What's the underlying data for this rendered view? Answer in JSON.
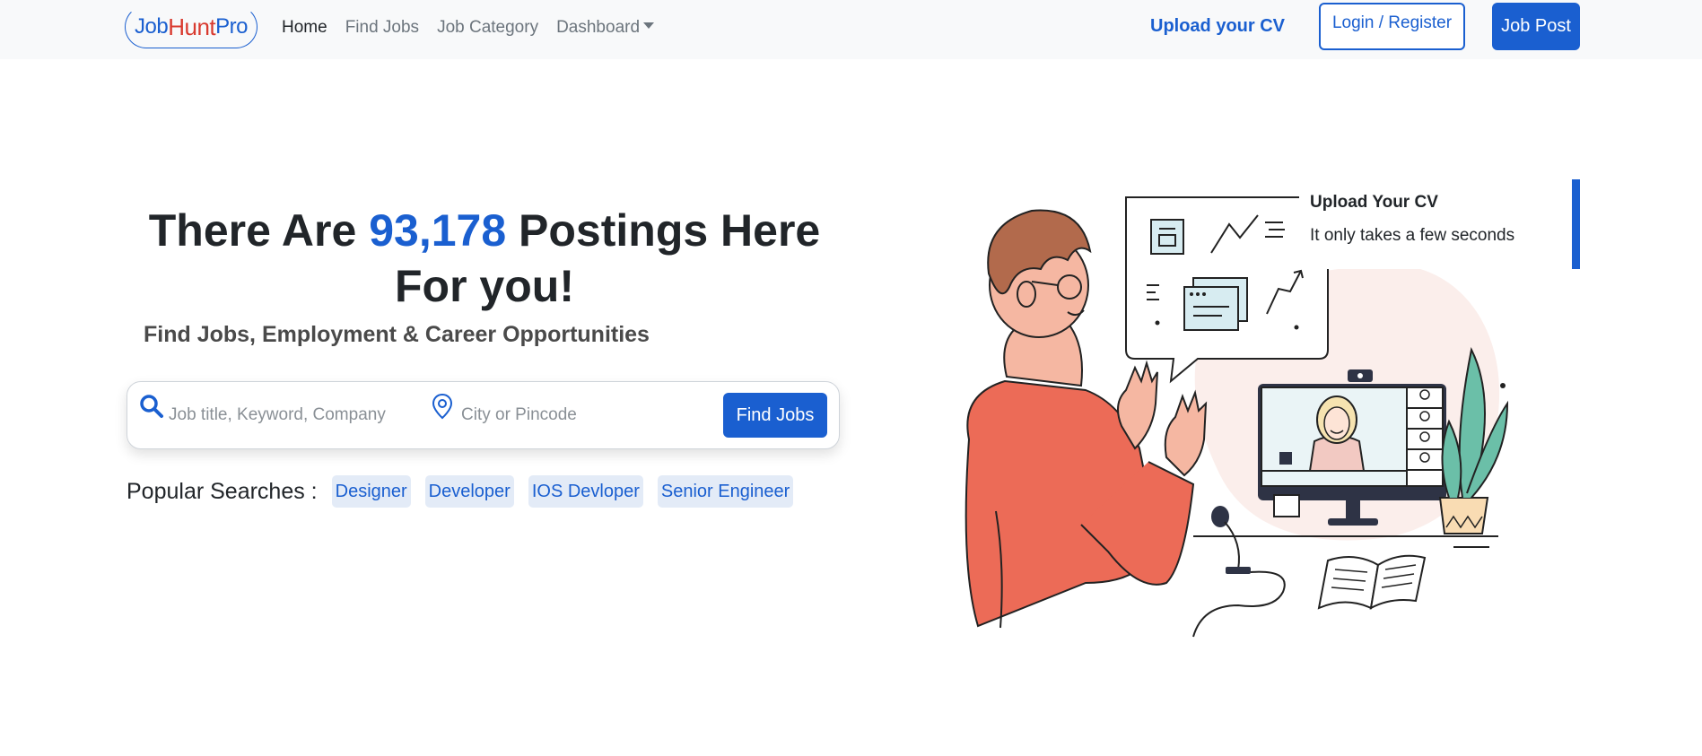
{
  "navbar": {
    "logo": {
      "part1": "Job",
      "part2": "Hunt",
      "part3": "Pro"
    },
    "links": [
      {
        "label": "Home"
      },
      {
        "label": "Find Jobs"
      },
      {
        "label": "Job Category"
      },
      {
        "label": "Dashboard"
      }
    ],
    "upload_cv": "Upload your CV",
    "login": "Login / Register",
    "job_post": "Job Post"
  },
  "hero": {
    "title_prefix": "There Are ",
    "count": "93,178",
    "title_suffix": " Postings Here For you!",
    "subtitle": "Find Jobs, Employment & Career Opportunities"
  },
  "search": {
    "keyword_placeholder": "Job title, Keyword, Company",
    "city_placeholder": "City or Pincode",
    "button": "Find Jobs"
  },
  "popular": {
    "label": "Popular Searches :",
    "tags": [
      "Designer",
      "Developer",
      "IOS Devloper",
      "Senior Engineer"
    ]
  },
  "upload_card": {
    "title": "Upload Your CV",
    "text": "It only takes a few seconds"
  },
  "colors": {
    "primary": "#1a5fd0",
    "logo_red": "#d93a2f",
    "shirt": "#ec6b57",
    "navbar_bg": "#f8f9fa"
  }
}
